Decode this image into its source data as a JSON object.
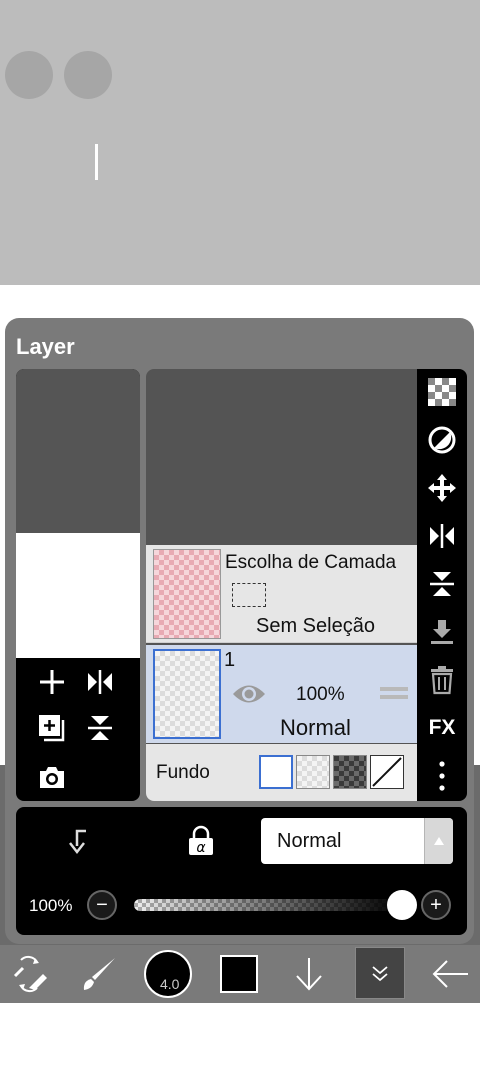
{
  "panel": {
    "title": "Layer"
  },
  "selection_row": {
    "title": "Escolha de Camada",
    "status": "Sem Seleção"
  },
  "layer_row": {
    "number": "1",
    "opacity": "100%",
    "blend": "Normal"
  },
  "fundo_row": {
    "label": "Fundo"
  },
  "side_toolbar": {
    "fx_label": "FX"
  },
  "blend_bar": {
    "mode": "Normal"
  },
  "opacity_bar": {
    "label": "100%",
    "value_fraction": 1.0,
    "minus": "−",
    "plus": "+"
  },
  "bottom_toolbar": {
    "brush_size": "4.0",
    "color": "#000000"
  },
  "colors": {
    "panel_bg": "#7a7a7a",
    "selected_layer_bg": "#cfd9ec",
    "selected_thumb_border": "#3b6fd1"
  }
}
